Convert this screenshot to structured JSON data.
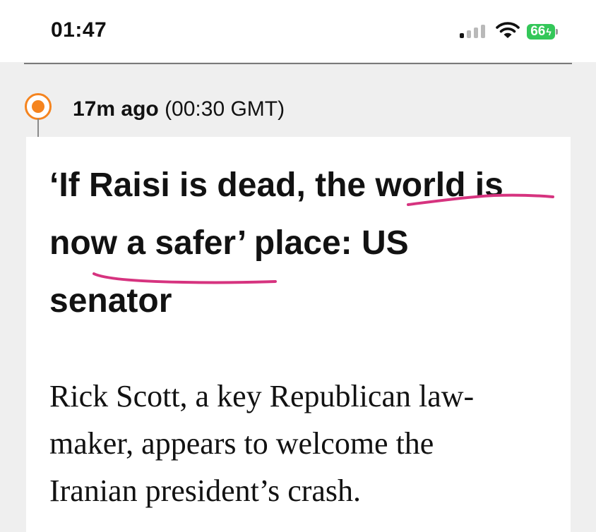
{
  "status_bar": {
    "time": "01:47",
    "battery_level": "66",
    "icons": [
      "cellular-signal-icon",
      "wifi-icon",
      "battery-charging-icon"
    ],
    "battery_color": "#34c759"
  },
  "entry": {
    "timestamp_relative": "17m ago",
    "timestamp_absolute": "(00:30 GMT)",
    "marker_color": "#f5841f",
    "headline_lines": [
      "‘If Raisi is dead, the world is",
      "now a safer’ place: US",
      "senator"
    ],
    "body_lines": [
      "Rick Scott, a key Republican law-",
      "maker, appears to welcome the",
      "Iranian president’s crash."
    ]
  },
  "annotations": {
    "underline_color": "#d6337f"
  }
}
